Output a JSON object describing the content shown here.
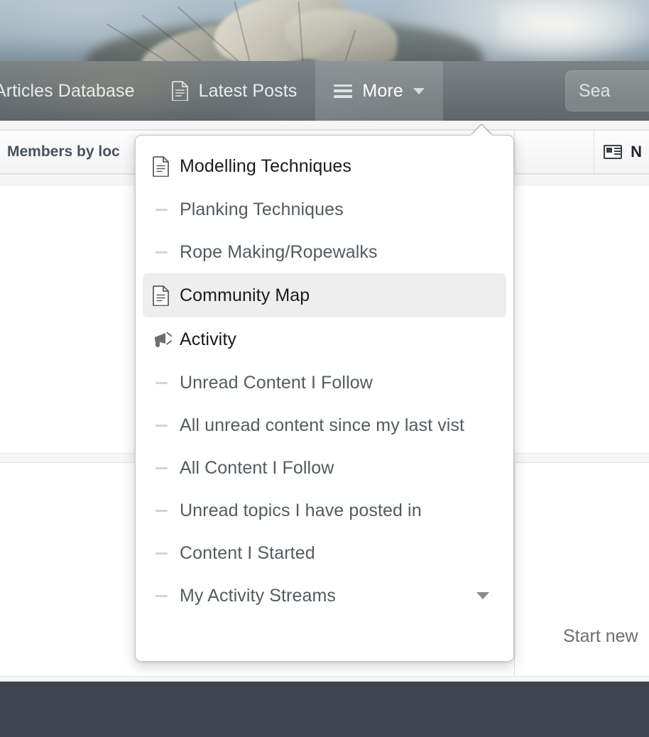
{
  "banner": {
    "alt": "sailing-ship-painting"
  },
  "navbar": {
    "items": [
      {
        "label": "Articles Database",
        "icon": null,
        "active": false
      },
      {
        "label": "Latest Posts",
        "icon": "document-icon",
        "active": false
      },
      {
        "label": "More",
        "icon": "hamburger-icon",
        "active": true,
        "caret": "chevron-down-icon"
      }
    ],
    "search": {
      "value": "",
      "placeholder": "Sea",
      "visible_text": "Sea"
    }
  },
  "page": {
    "panel_header_left": "Members by loc",
    "panel_header_right": "N",
    "panel_header_right_icon": "newspaper-icon",
    "start_new_label": "Start new"
  },
  "dropdown": {
    "arrow": "menu-pointer",
    "items": [
      {
        "id": "modelling-techniques",
        "label": "Modelling Techniques",
        "type": "header",
        "icon": "document-icon",
        "highlight": false
      },
      {
        "id": "planking-techniques",
        "label": "Planking Techniques",
        "type": "sub",
        "icon": "dash-bullet",
        "highlight": false
      },
      {
        "id": "rope-making-ropewalks",
        "label": "Rope Making/Ropewalks",
        "type": "sub",
        "icon": "dash-bullet",
        "highlight": false
      },
      {
        "id": "community-map",
        "label": "Community Map",
        "type": "header",
        "icon": "document-icon",
        "highlight": true
      },
      {
        "id": "activity",
        "label": "Activity",
        "type": "header",
        "icon": "megaphone-icon",
        "highlight": false
      },
      {
        "id": "unread-content-i-follow",
        "label": "Unread Content I Follow",
        "type": "sub",
        "icon": "dash-bullet",
        "highlight": false
      },
      {
        "id": "all-unread-content-since-my-last-vist",
        "label": "All unread content since my last vist",
        "type": "sub",
        "icon": "dash-bullet",
        "highlight": false
      },
      {
        "id": "all-content-i-follow",
        "label": "All Content I Follow",
        "type": "sub",
        "icon": "dash-bullet",
        "highlight": false
      },
      {
        "id": "unread-topics-i-have-posted-in",
        "label": "Unread topics I have posted in",
        "type": "sub",
        "icon": "dash-bullet",
        "highlight": false
      },
      {
        "id": "content-i-started",
        "label": "Content I Started",
        "type": "sub",
        "icon": "dash-bullet",
        "highlight": false
      },
      {
        "id": "my-activity-streams",
        "label": "My Activity Streams",
        "type": "sub",
        "icon": "dash-bullet",
        "highlight": false,
        "caret": "chevron-down-icon"
      }
    ]
  },
  "colors": {
    "navbar_overlay": "#485256",
    "menu_highlight": "#eeeeee",
    "footer": "#40444f",
    "page_bg": "#f5f5f5",
    "header_text": "#4a505c"
  }
}
